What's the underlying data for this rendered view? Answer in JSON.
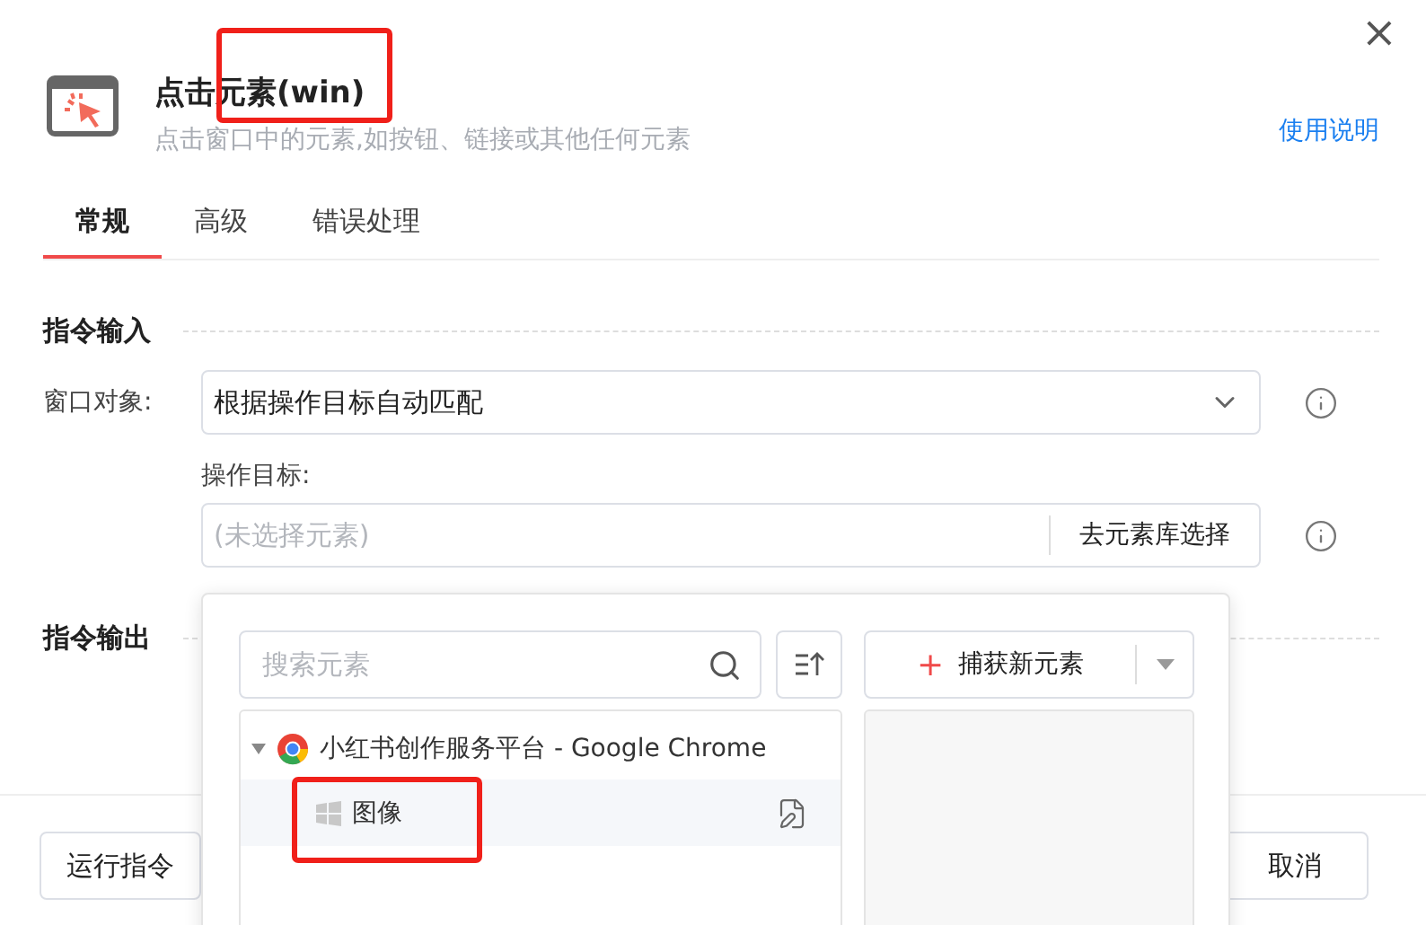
{
  "dialog": {
    "title": "点击元素(win)",
    "subtitle": "点击窗口中的元素,如按钮、链接或其他任何元素",
    "help_link": "使用说明",
    "close": "×"
  },
  "tabs": [
    {
      "label": "常规",
      "selected": true
    },
    {
      "label": "高级",
      "selected": false
    },
    {
      "label": "错误处理",
      "selected": false
    }
  ],
  "input_section": {
    "title": "指令输入",
    "window_label": "窗口对象:",
    "window_value": "根据操作目标自动匹配",
    "target_label": "操作目标:",
    "target_placeholder": "(未选择元素)",
    "library_button": "去元素库选择"
  },
  "output_section": {
    "title": "指令输出"
  },
  "element_picker": {
    "search_placeholder": "搜索元素",
    "capture_icon": "+",
    "capture_button": "捕获新元素",
    "tree": [
      {
        "label": "小红书创作服务平台 - Google Chrome",
        "expanded": true,
        "children": [
          {
            "label": "图像",
            "selected": true
          }
        ]
      }
    ]
  },
  "footer": {
    "run_button": "运行指令",
    "cancel_button": "取消"
  },
  "annotations": [
    {
      "kind": "box"
    },
    {
      "kind": "box"
    }
  ]
}
